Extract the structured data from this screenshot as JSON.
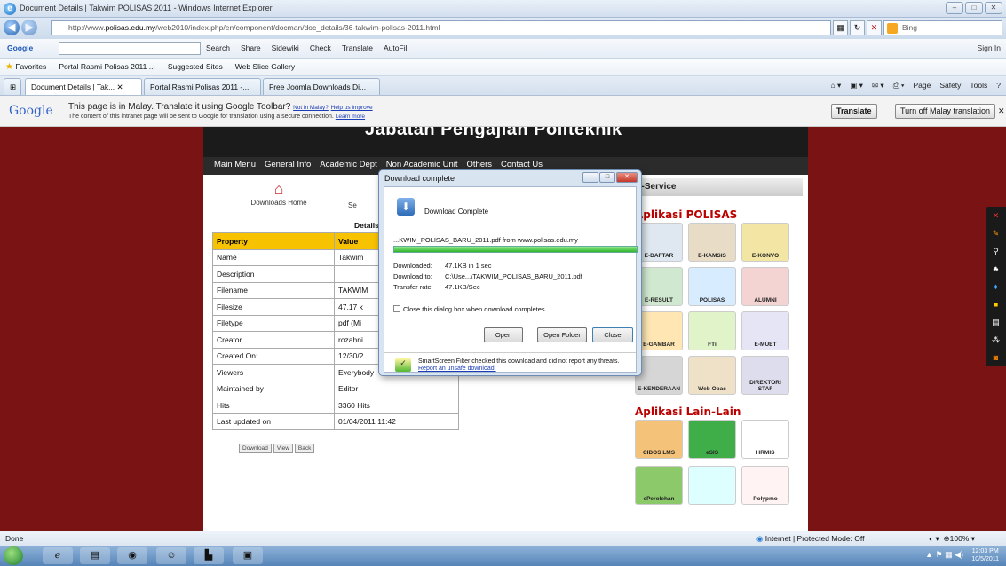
{
  "window": {
    "title": "Document Details | Takwim POLISAS 2011 - Windows Internet Explorer"
  },
  "address": {
    "url_prefix": "http://www.",
    "url_host": "polisas.edu.my",
    "url_path": "/web2010/index.php/en/component/docman/doc_details/36-takwim-polisas-2011.html",
    "search_placeholder": "Bing"
  },
  "google_toolbar": {
    "label": "Google",
    "items": [
      "Search",
      "Share",
      "Sidewiki",
      "Check",
      "Translate",
      "AutoFill"
    ],
    "signin": "Sign In"
  },
  "favorites": {
    "label": "Favorites",
    "items": [
      "Portal Rasmi Polisas 2011 ...",
      "Suggested Sites",
      "Web Slice Gallery"
    ]
  },
  "tabs": [
    "Document Details | Tak...",
    "Portal Rasmi Polisas 2011 -...",
    "Free Joomla Downloads Di..."
  ],
  "tab_tools": [
    "Page",
    "Safety",
    "Tools"
  ],
  "translate_bar": {
    "logo": "Google",
    "message": "This page is in Malay.  Translate it using Google Toolbar?",
    "not_malay": "Not in Malay?",
    "help": "Help us improve",
    "sub": "The content of this intranet page will be sent to Google for translation using a secure connection.",
    "learn": "Learn more",
    "translate_btn": "Translate",
    "turn_off_btn": "Turn off Malay translation"
  },
  "site": {
    "banner": "Jabatan Pengajian Politeknik",
    "menu": [
      "Main Menu",
      "General Info",
      "Academic Dept",
      "Non Academic Unit",
      "Others",
      "Contact Us"
    ],
    "downloads_home": "Downloads Home",
    "search_partial": "Se",
    "details_label": "Details",
    "props_headers": [
      "Property",
      "Value"
    ],
    "props": [
      {
        "k": "Name",
        "v": "Takwim"
      },
      {
        "k": "Description",
        "v": ""
      },
      {
        "k": "Filename",
        "v": "TAKWIM"
      },
      {
        "k": "Filesize",
        "v": "47.17 k"
      },
      {
        "k": "Filetype",
        "v": "pdf (Mi"
      },
      {
        "k": "Creator",
        "v": "rozahni"
      },
      {
        "k": "Created On:",
        "v": "12/30/2"
      },
      {
        "k": "Viewers",
        "v": "Everybody"
      },
      {
        "k": "Maintained by",
        "v": "Editor"
      },
      {
        "k": "Hits",
        "v": "3360 Hits"
      },
      {
        "k": "Last updated on",
        "v": "01/04/2011 11:42"
      }
    ],
    "small_buttons": [
      "Download",
      "View",
      "Back"
    ],
    "eservice": "e-Service",
    "aplikasi_polisas": "Aplikasi POLISAS",
    "aplikasi_lain": "Aplikasi Lain-Lain",
    "apps": [
      "E-DAFTAR",
      "E-KAMSIS",
      "E-KONVO",
      "E-RESULT",
      "POLISAS",
      "ALUMNI",
      "E-GAMBAR",
      "FTi",
      "E-MUET",
      "E-KENDERAAN",
      "Web Opac",
      "DIREKTORI STAF"
    ],
    "apps2": [
      "CIDOS LMS",
      "eSIS",
      "HRMIS",
      "ePerolehan",
      "",
      "Polypmo"
    ]
  },
  "dialog": {
    "title": "Download complete",
    "heading": "Download Complete",
    "file": "...KWIM_POLISAS_BARU_2011.pdf from www.polisas.edu.my",
    "progress_pct": 100,
    "downloaded_label": "Downloaded:",
    "downloaded": "47.1KB in 1 sec",
    "to_label": "Download to:",
    "to": "C:\\Use...\\TAKWIM_POLISAS_BARU_2011.pdf",
    "rate_label": "Transfer rate:",
    "rate": "47.1KB/Sec",
    "close_check": "Close this dialog box when download completes",
    "open_btn": "Open",
    "open_folder_btn": "Open Folder",
    "close_btn": "Close",
    "smartscreen": "SmartScreen Filter checked this download and did not report any threats.",
    "report_link": "Report an unsafe download."
  },
  "status": {
    "left": "Done",
    "zone": "Internet | Protected Mode: Off",
    "zoom": "100%"
  },
  "clock": {
    "time": "12:03 PM",
    "date": "10/5/2011"
  }
}
